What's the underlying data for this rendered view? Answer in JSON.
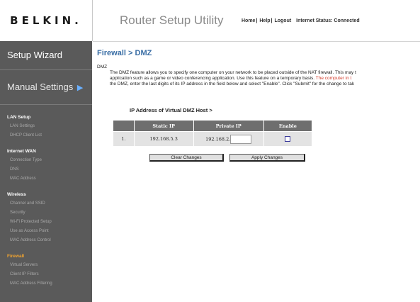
{
  "brand": {
    "logo_text": "BELKIN."
  },
  "header": {
    "title": "Router Setup Utility",
    "links": [
      "Home",
      "Help",
      "Logout"
    ],
    "internet_status": "Internet Status: Connected"
  },
  "sidebar": {
    "wizard": "Setup Wizard",
    "manual": "Manual Settings",
    "sections": [
      {
        "title": "LAN Setup",
        "items": [
          "LAN Settings",
          "DHCP Client List"
        ]
      },
      {
        "title": "Internet WAN",
        "items": [
          "Connection Type",
          "DNS",
          "MAC Address"
        ]
      },
      {
        "title": "Wireless",
        "items": [
          "Channel and SSID",
          "Security",
          "Wi-Fi Protected Setup",
          "Use as Access Point",
          "MAC Address Control"
        ]
      },
      {
        "title": "Firewall",
        "items": [
          "Virtual Servers",
          "Client IP Filters",
          "MAC Address Filtering"
        ]
      }
    ]
  },
  "main": {
    "breadcrumb": "Firewall > DMZ",
    "section_label": "DMZ",
    "description": {
      "line1": "The DMZ feature allows you to specify one computer on your network to be placed outside of the NAT firewall. This may t",
      "line2a": "application such as a game or video conferencing application. Use this feature on a temporary basis.",
      "line2b": " The computer in t",
      "line3": "the DMZ, enter the last digits of its IP address in the field below and select \"Enable\". Click \"Submit\" for the change to tak"
    },
    "virtual_host_label": "IP Address of Virtual DMZ Host >",
    "table": {
      "headers": [
        "",
        "Static IP",
        "Private IP",
        "Enable"
      ],
      "rows": [
        {
          "index": "1.",
          "static_ip": "192.168.5.3",
          "private_ip_prefix": "192.168.2.",
          "private_ip_value": "",
          "enabled": false
        }
      ]
    },
    "buttons": {
      "clear": "Clear Changes",
      "apply": "Apply Changes"
    }
  }
}
